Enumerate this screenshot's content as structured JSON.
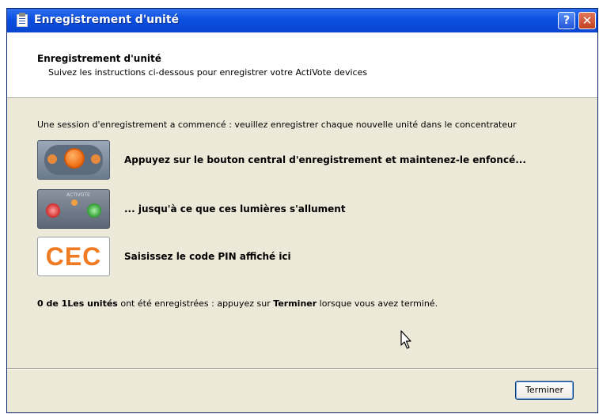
{
  "window": {
    "title": "Enregistrement d'unité",
    "help_label": "?",
    "close_label": "✕"
  },
  "header": {
    "title": "Enregistrement d'unité",
    "subtitle": "Suivez les instructions ci-dessous pour enregistrer votre ActiVote devices"
  },
  "body": {
    "status": "Une session d'enregistrement a commencé : veuillez enregistrer chaque nouvelle unité dans le concentrateur",
    "steps": [
      {
        "icon": "remote-center-button-image",
        "text": "Appuyez sur le bouton central d'enregistrement et maintenez-le enfoncé..."
      },
      {
        "icon": "remote-lights-image",
        "text": "... jusqu'à ce que ces lumières s'allument"
      },
      {
        "icon": "pin-code-image",
        "code": "CEC",
        "text": "Saisissez le code PIN affiché ici"
      }
    ],
    "count_bold": "0 de 1Les unités",
    "count_mid": " ont été enregistrées : appuyez sur ",
    "count_terminer": "Terminer",
    "count_end": " lorsque vous avez terminé.",
    "remote_label": "ACTIVOTE"
  },
  "footer": {
    "finish_label": "Terminer"
  },
  "colors": {
    "title_bar": "#0b4fe0",
    "dialog_bg": "#ece9d8",
    "pin_code": "#f07a22"
  }
}
